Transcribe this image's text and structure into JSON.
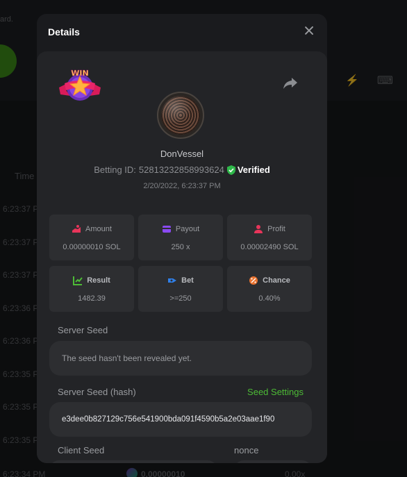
{
  "background": {
    "top_text": "ard.",
    "time_header": "Time",
    "times": [
      "6:23:37 P",
      "6:23:37 P",
      "6:23:37 P",
      "6:23:36 P",
      "6:23:36 P",
      "6:23:35 P",
      "6:23:35 P",
      "6:23:35 P"
    ],
    "bottom_row": {
      "time": "6:23:34 PM",
      "amount": "0.00000010",
      "multiplier": "0.00x"
    }
  },
  "modal": {
    "title": "Details",
    "user": {
      "name": "DonVessel",
      "betting_id_label": "Betting ID:",
      "betting_id": "52813232858993624",
      "verified_label": "Verified",
      "date": "2/20/2022, 6:23:37 PM"
    },
    "stats": [
      {
        "label": "Amount",
        "value": "0.00000010 SOL",
        "icon": "amount-icon",
        "color": "#e8355a"
      },
      {
        "label": "Payout",
        "value": "250 x",
        "icon": "payout-icon",
        "color": "#8a4af3"
      },
      {
        "label": "Profit",
        "value": "0.00002490 SOL",
        "icon": "profit-icon",
        "color": "#e8355a"
      },
      {
        "label": "Result",
        "value": "1482.39",
        "icon": "result-icon",
        "color": "#4dbb36"
      },
      {
        "label": "Bet",
        "value": ">=250",
        "icon": "bet-icon",
        "color": "#2f7fe8"
      },
      {
        "label": "Chance",
        "value": "0.40%",
        "icon": "chance-icon",
        "color": "#e8722f"
      }
    ],
    "server_seed": {
      "label": "Server Seed",
      "value": "The seed hasn't been revealed yet."
    },
    "server_seed_hash": {
      "label": "Server Seed (hash)",
      "link": "Seed Settings",
      "value": "e3dee0b827129c756e541900bda091f4590b5a2e03aae1f90"
    },
    "client_seed": {
      "label": "Client Seed"
    },
    "nonce": {
      "label": "nonce"
    }
  },
  "colors": {
    "accent_green": "#4dbb36",
    "modal_bg": "#1a1b1e",
    "panel_bg": "#232427",
    "cell_bg": "#2d2e31"
  }
}
